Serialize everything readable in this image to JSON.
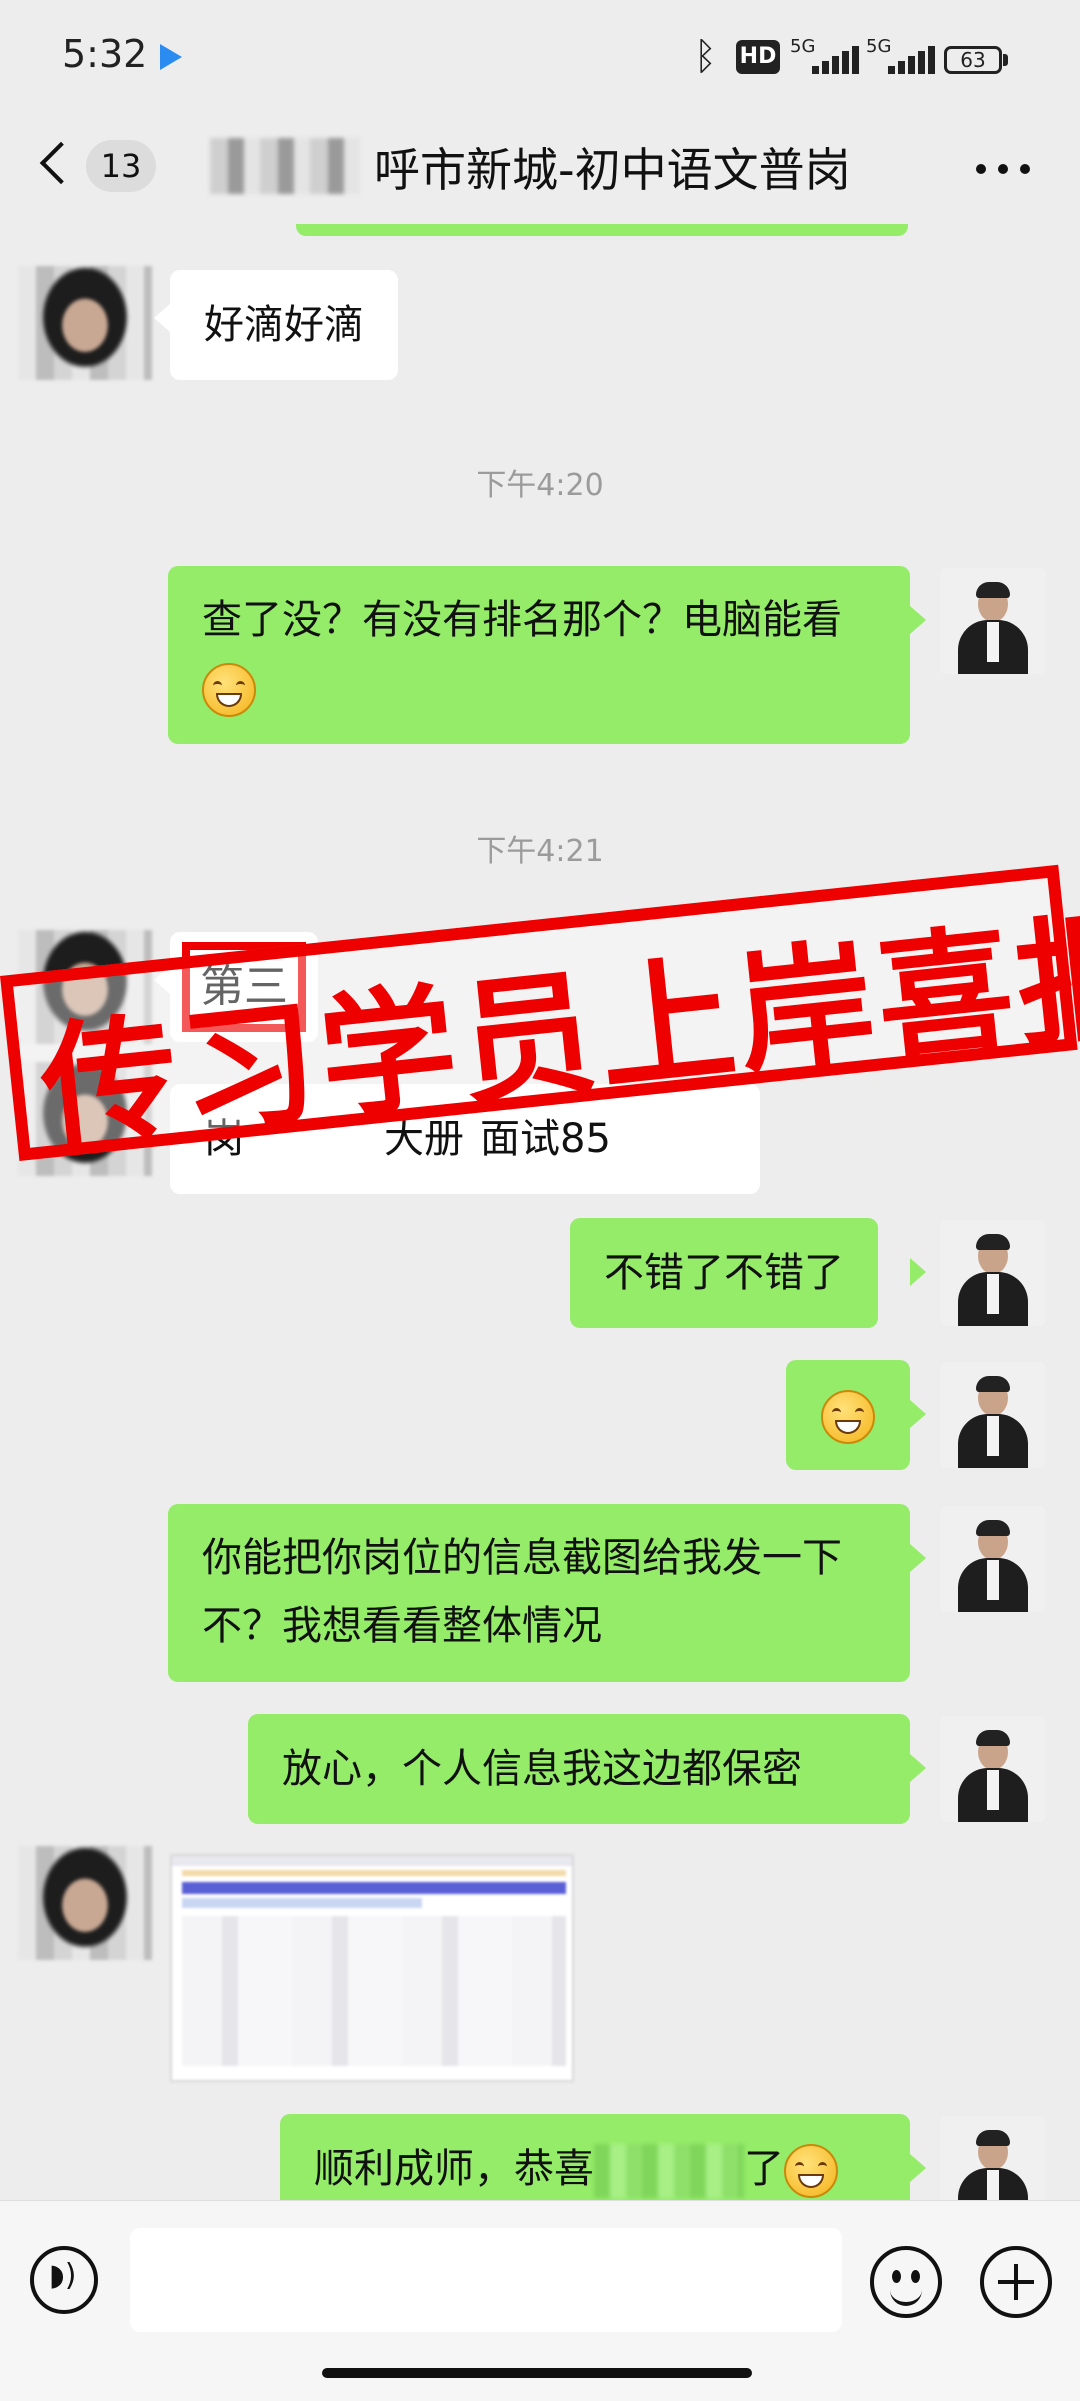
{
  "status_bar": {
    "time": "5:32",
    "hd_label": "HD",
    "sim1": "5G",
    "sim2": "5G",
    "battery": "63"
  },
  "header": {
    "unread_count": "13",
    "title": "呼市新城-初中语文普岗"
  },
  "messages": {
    "m1": "好滴好滴",
    "t1": "下午4:20",
    "m2": "查了没？有没有排名那个？电脑能看",
    "t2": "下午4:21",
    "m3": "第三",
    "m4_visible": "岗",
    "m4_tail": "大册",
    "m4_tail2": "面试85",
    "m5": "不错了不错了",
    "m7": "你能把你岗位的信息截图给我发一下不？我想看看整体情况",
    "m8": "放心，个人信息我这边都保密",
    "m9_prefix": "顺利成师，恭喜",
    "m9_suffix": "了"
  },
  "stamp": {
    "text": "传习学员上岸喜报",
    "color": "#e00000"
  },
  "colors": {
    "bubble_self": "#95ec69",
    "bubble_other": "#ffffff",
    "background": "#ededed"
  },
  "icons": [
    "back-chevron-icon",
    "more-icon",
    "voice-icon",
    "emoji-icon",
    "plus-icon",
    "bluetooth-icon",
    "signal-icon",
    "battery-icon"
  ]
}
